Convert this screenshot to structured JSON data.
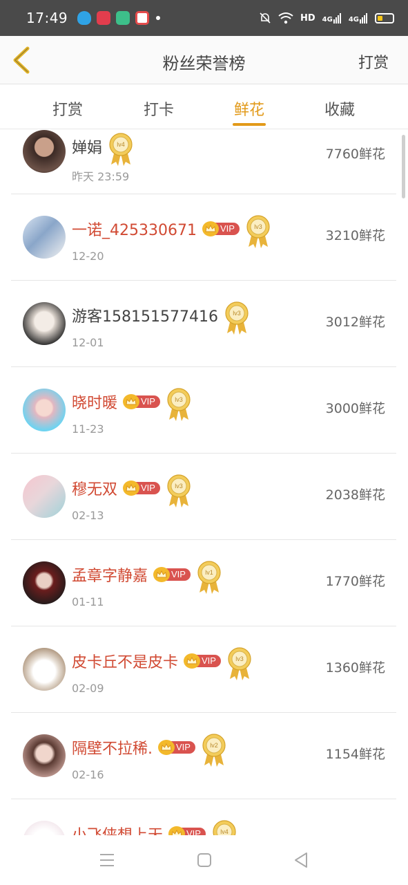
{
  "status_bar": {
    "time": "17:49",
    "network": "HD",
    "signal_1": "4G",
    "signal_2": "4G"
  },
  "nav": {
    "title": "粉丝荣誉榜",
    "action": "打赏",
    "back_icon": "chevron-left-icon"
  },
  "tabs": [
    {
      "label": "打赏",
      "active": false
    },
    {
      "label": "打卡",
      "active": false
    },
    {
      "label": "鲜花",
      "active": true
    },
    {
      "label": "收藏",
      "active": false
    }
  ],
  "colors": {
    "accent": "#e29a1a",
    "vip_name": "#d14a33",
    "vip_badge": "#d9534f",
    "gold": "#e8b33a"
  },
  "fans": [
    {
      "name": "婵娟",
      "vip": false,
      "level": "lv4",
      "date": "昨天 23:59",
      "count": "7760鲜花"
    },
    {
      "name": "一诺_425330671",
      "vip": true,
      "level": "lv3",
      "date": "12-20",
      "count": "3210鲜花"
    },
    {
      "name": "游客158151577416",
      "vip": false,
      "level": "lv3",
      "date": "12-01",
      "count": "3012鲜花"
    },
    {
      "name": "晓时暖",
      "vip": true,
      "level": "lv3",
      "date": "11-23",
      "count": "3000鲜花"
    },
    {
      "name": "穆无双",
      "vip": true,
      "level": "lv3",
      "date": "02-13",
      "count": "2038鲜花"
    },
    {
      "name": "孟章字静嘉",
      "vip": true,
      "level": "lv1",
      "date": "01-11",
      "count": "1770鲜花"
    },
    {
      "name": "皮卡丘不是皮卡",
      "vip": true,
      "level": "lv3",
      "date": "02-09",
      "count": "1360鲜花"
    },
    {
      "name": "隔壁不拉稀.",
      "vip": true,
      "level": "lv2",
      "date": "02-16",
      "count": "1154鲜花"
    },
    {
      "name": "小飞侠想上天",
      "vip": true,
      "level": "lv4",
      "date": "",
      "count": ""
    }
  ],
  "vip_label": "VIP",
  "system_nav": [
    "menu-icon",
    "home-icon",
    "back-triangle-icon"
  ]
}
